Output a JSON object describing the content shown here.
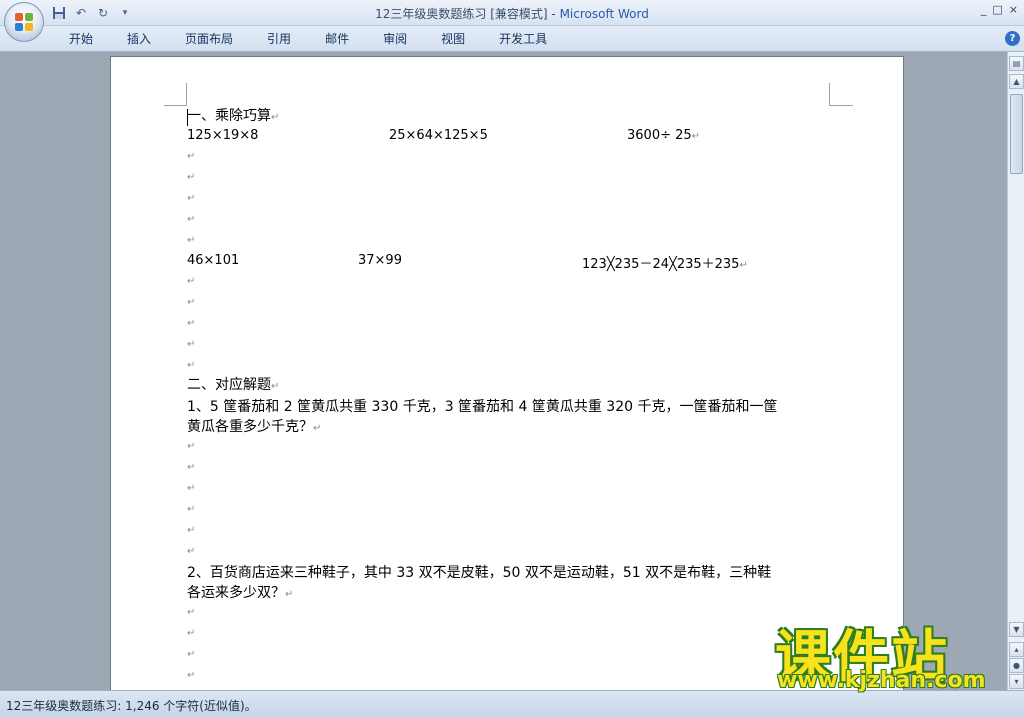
{
  "window": {
    "title_doc": "12三年级奥数题练习 [兼容模式] - ",
    "title_app": "Microsoft Word",
    "controls": [
      "_",
      "□",
      "×"
    ]
  },
  "ribbon": {
    "tabs": [
      "开始",
      "插入",
      "页面布局",
      "引用",
      "邮件",
      "审阅",
      "视图",
      "开发工具"
    ],
    "help": "?"
  },
  "document": {
    "pilcrow": "↵",
    "s1_heading": "一、乘除巧算",
    "expr1": "125×19×8",
    "expr2": "25×64×125×5",
    "expr3": "3600÷ 25",
    "expr4": "46×101",
    "expr5": "37×99",
    "expr6": "123╳235－24╳235＋235",
    "s2_heading": "二、对应解题",
    "q1_line1": "1、5 筐番茄和 2 筐黄瓜共重 330 千克，3 筐番茄和 4 筐黄瓜共重 320 千克，一筐番茄和一筐",
    "q1_line2": "黄瓜各重多少千克？",
    "q2_line1": "2、百货商店运来三种鞋子，其中 33 双不是皮鞋，50 双不是运动鞋，51 双不是布鞋，三种鞋",
    "q2_line2": "各运来多少双？"
  },
  "status": {
    "text": "12三年级奥数题练习: 1,246 个字符(近似值)。"
  },
  "watermark": {
    "big": "课件站",
    "url": "www.kjzhan.com"
  },
  "colors": {
    "accent": "#2a5aa8",
    "watermark_fill": "#f7e21b",
    "watermark_stroke": "#2e7d1e"
  }
}
